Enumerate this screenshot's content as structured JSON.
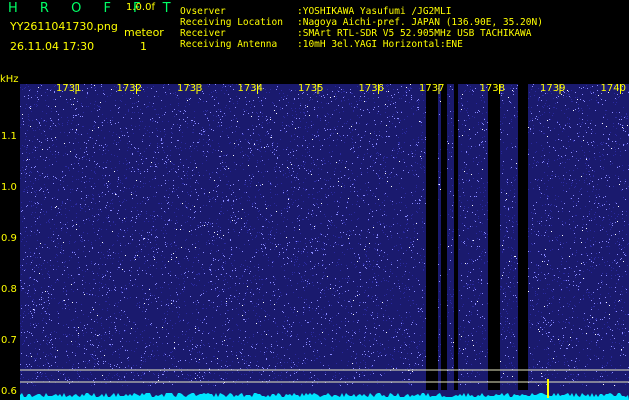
{
  "header": {
    "brand": "H R O F F T",
    "version": "1.0.0f",
    "filename": "YY2611041730.png",
    "datetime": "26.11.04 17:30",
    "event_label": "meteor",
    "event_count": "1"
  },
  "station": [
    {
      "key": "Ovserver",
      "value": ":YOSHIKAWA Yasufumi /JG2MLI"
    },
    {
      "key": "Receiving Location",
      "value": ":Nagoya Aichi-pref. JAPAN (136.90E, 35.20N)"
    },
    {
      "key": "Receiver",
      "value": ":SMArt RTL-SDR V5 52.905MHz USB TACHIKAWA"
    },
    {
      "key": "Receiving Antenna",
      "value": ":10mH 3el.YAGI Horizontal:ENE"
    }
  ],
  "chart_data": {
    "type": "heatmap",
    "ylabel": "kHz",
    "time_ticks": [
      "1731",
      "1732",
      "1733",
      "1734",
      "1735",
      "1736",
      "1737",
      "1738",
      "1739",
      "1740"
    ],
    "freq_ticks": [
      "1.1",
      "1.0",
      "0.9",
      "0.8",
      "0.7",
      "0.6"
    ],
    "freq_tick_values": [
      1.1,
      1.0,
      0.9,
      0.8,
      0.7,
      0.6
    ],
    "ylim": [
      0.58,
      1.2
    ],
    "colors": {
      "background": "#1a1a6e",
      "noise_dot_dim": "#2a2aa0",
      "noise_dot_bright": "#8a8aff",
      "noise_dot_white": "#ffffff",
      "dropout": "#000000",
      "baseline": "#00e5ff",
      "marker_line": "#e8e8c0",
      "meteor": "#ffff00"
    }
  }
}
